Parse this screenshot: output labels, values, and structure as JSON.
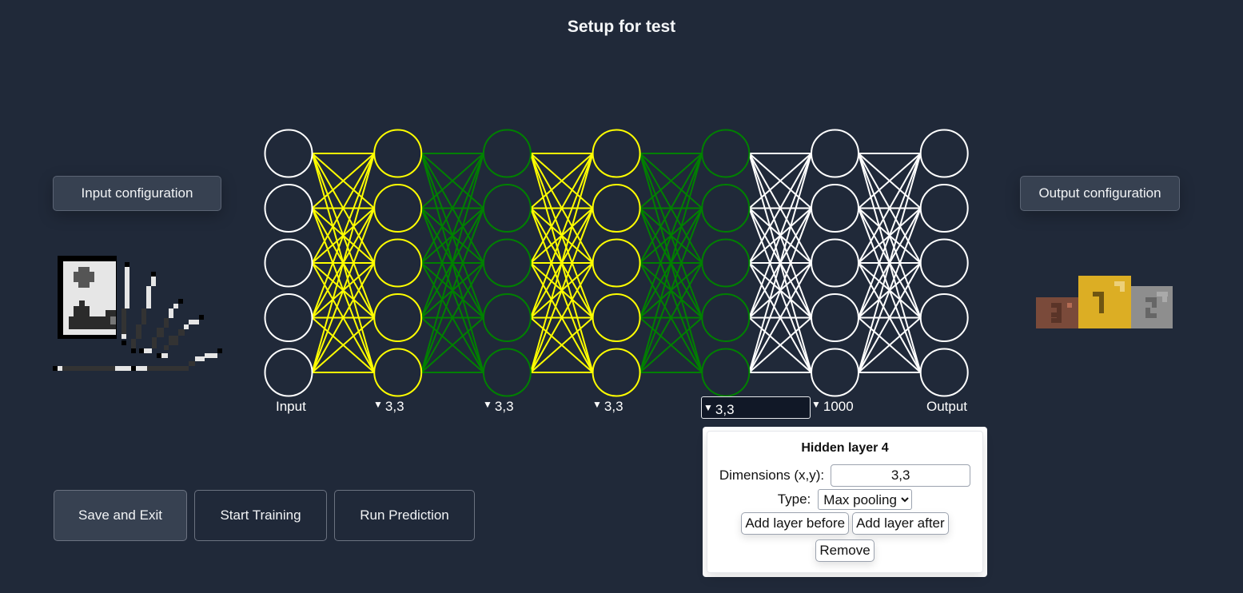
{
  "page": {
    "title": "Setup for test"
  },
  "config": {
    "input_button": "Input configuration",
    "output_button": "Output configuration",
    "input_icon": "image-and-audio-input-icon",
    "output_icon": "podium-ranking-icon"
  },
  "network": {
    "nodes_per_layer": 5,
    "layers": [
      {
        "label": "Input",
        "color": "#ffffff",
        "has_dropdown": false,
        "selected": false
      },
      {
        "label": "3,3",
        "color": "#ffff00",
        "has_dropdown": true,
        "selected": false
      },
      {
        "label": "3,3",
        "color": "#008000",
        "has_dropdown": true,
        "selected": false
      },
      {
        "label": "3,3",
        "color": "#ffff00",
        "has_dropdown": true,
        "selected": false
      },
      {
        "label": "3,3",
        "color": "#008000",
        "has_dropdown": true,
        "selected": true
      },
      {
        "label": "1000",
        "color": "#ffffff",
        "has_dropdown": true,
        "selected": false
      },
      {
        "label": "Output",
        "color": "#ffffff",
        "has_dropdown": false,
        "selected": false
      }
    ],
    "dropdown_glyph": "▼"
  },
  "actions": {
    "save_exit": "Save and Exit",
    "start_training": "Start Training",
    "run_prediction": "Run Prediction"
  },
  "layer_popup": {
    "title": "Hidden layer 4",
    "dimensions_label": "Dimensions (x,y):",
    "dimensions_value": "3,3",
    "type_label": "Type:",
    "type_value": "Max pooling",
    "add_before": "Add layer before",
    "add_after": "Add layer after",
    "remove": "Remove"
  },
  "colors": {
    "background": "#202939",
    "dense_layer": "#ffffff",
    "conv_layer": "#ffff00",
    "pool_layer": "#008000"
  }
}
